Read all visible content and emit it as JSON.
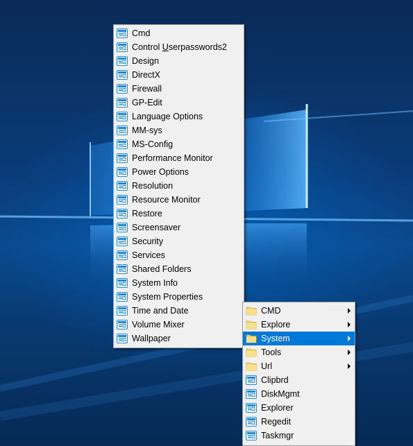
{
  "main_menu": {
    "items": [
      {
        "label": "Cmd"
      },
      {
        "label": "Control Userpasswords2",
        "pre": "Control ",
        "accel": "U",
        "post": "serpasswords2"
      },
      {
        "label": "Design"
      },
      {
        "label": "DirectX"
      },
      {
        "label": "Firewall"
      },
      {
        "label": "GP-Edit"
      },
      {
        "label": "Language Options"
      },
      {
        "label": "MM-sys"
      },
      {
        "label": "MS-Config"
      },
      {
        "label": "Performance Monitor"
      },
      {
        "label": "Power Options"
      },
      {
        "label": "Resolution"
      },
      {
        "label": "Resource Monitor"
      },
      {
        "label": "Restore"
      },
      {
        "label": "Screensaver"
      },
      {
        "label": "Security"
      },
      {
        "label": "Services"
      },
      {
        "label": "Shared Folders"
      },
      {
        "label": "System Info"
      },
      {
        "label": "System Properties"
      },
      {
        "label": "Time and Date"
      },
      {
        "label": "Volume Mixer"
      },
      {
        "label": "Wallpaper"
      }
    ]
  },
  "submenu": {
    "folders": [
      {
        "label": "CMD",
        "selected": false
      },
      {
        "label": "Explore",
        "selected": false
      },
      {
        "label": "System",
        "selected": true
      },
      {
        "label": "Tools",
        "selected": false
      },
      {
        "label": "Url",
        "selected": false
      }
    ],
    "shortcuts": [
      {
        "label": "Clipbrd"
      },
      {
        "label": "DiskMgmt"
      },
      {
        "label": "Explorer"
      },
      {
        "label": "Regedit"
      },
      {
        "label": "Taskmgr"
      }
    ]
  },
  "colors": {
    "selection": "#0078d7",
    "menu_background": "#f0f0f0",
    "folder": "#f5d66b",
    "shortcut_icon": "#1e88d8"
  },
  "icons": {
    "shortcut": "shortcut-icon",
    "folder": "folder-icon",
    "submenu_arrow": "chevron-right-icon"
  }
}
